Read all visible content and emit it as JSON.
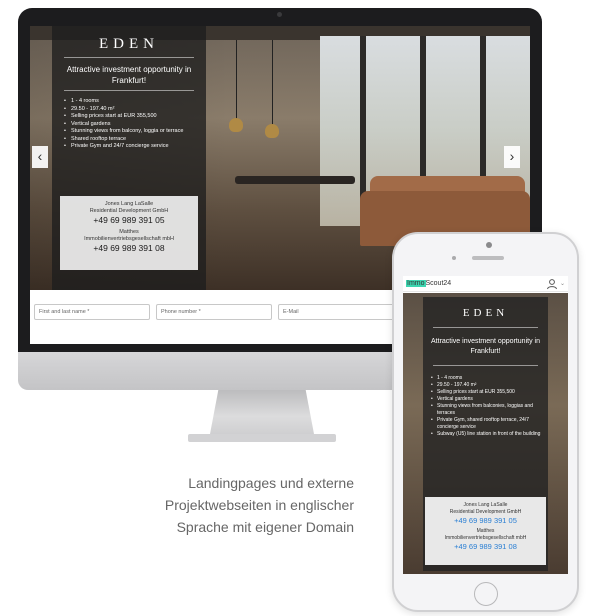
{
  "desktop": {
    "brand": "EDEN",
    "tagline": "Attractive investment opportunity in Frankfurt!",
    "features": [
      "1 - 4 rooms",
      "29.50 - 197.40 m²",
      "Selling prices start at EUR 355,500",
      "Vertical gardens",
      "Stunning views from balcony, loggia or terrace",
      "Shared rooftop terrace",
      "Private Gym and 24/7 concierge service"
    ],
    "contact": {
      "company1": "Jones Lang LaSalle",
      "company1_sub": "Residential Development GmbH",
      "phone1": "+49 69 989 391 05",
      "company2": "Matthes",
      "company2_sub": "Immobilienvertriebsgesellschaft mbH",
      "phone2": "+49 69 989 391 08"
    },
    "prev_arrow": "‹",
    "next_arrow": "›",
    "form": {
      "name_placeholder": "First and last name *",
      "phone_placeholder": "Phone number *",
      "email_placeholder": "E-Mail"
    }
  },
  "caption": {
    "line1": "Landingpages und externe",
    "line2": "Projektwebseiten in englischer",
    "line3": "Sprache mit eigener Domain"
  },
  "phone": {
    "logo_highlight": "Immo",
    "logo_rest": "Scout24",
    "brand": "EDEN",
    "tagline": "Attractive investment opportunity in Frankfurt!",
    "features": [
      "1 - 4 rooms",
      "29.50 - 197.40 m²",
      "Selling prices start at EUR 355,500",
      "Vertical gardens",
      "Stunning views from balconies, loggias and terraces",
      "Private Gym, shared rooftop terrace, 24/7 concierge service",
      "Subway (U5) line station in front of the building"
    ],
    "contact": {
      "company1": "Jones Lang LaSalle",
      "company1_sub": "Residential Development GmbH",
      "phone1": "+49 69 989 391 05",
      "company2": "Matthes",
      "company2_sub": "Immobilienvertriebsgesellschaft mbH",
      "phone2": "+49 69 989 391 08"
    }
  }
}
